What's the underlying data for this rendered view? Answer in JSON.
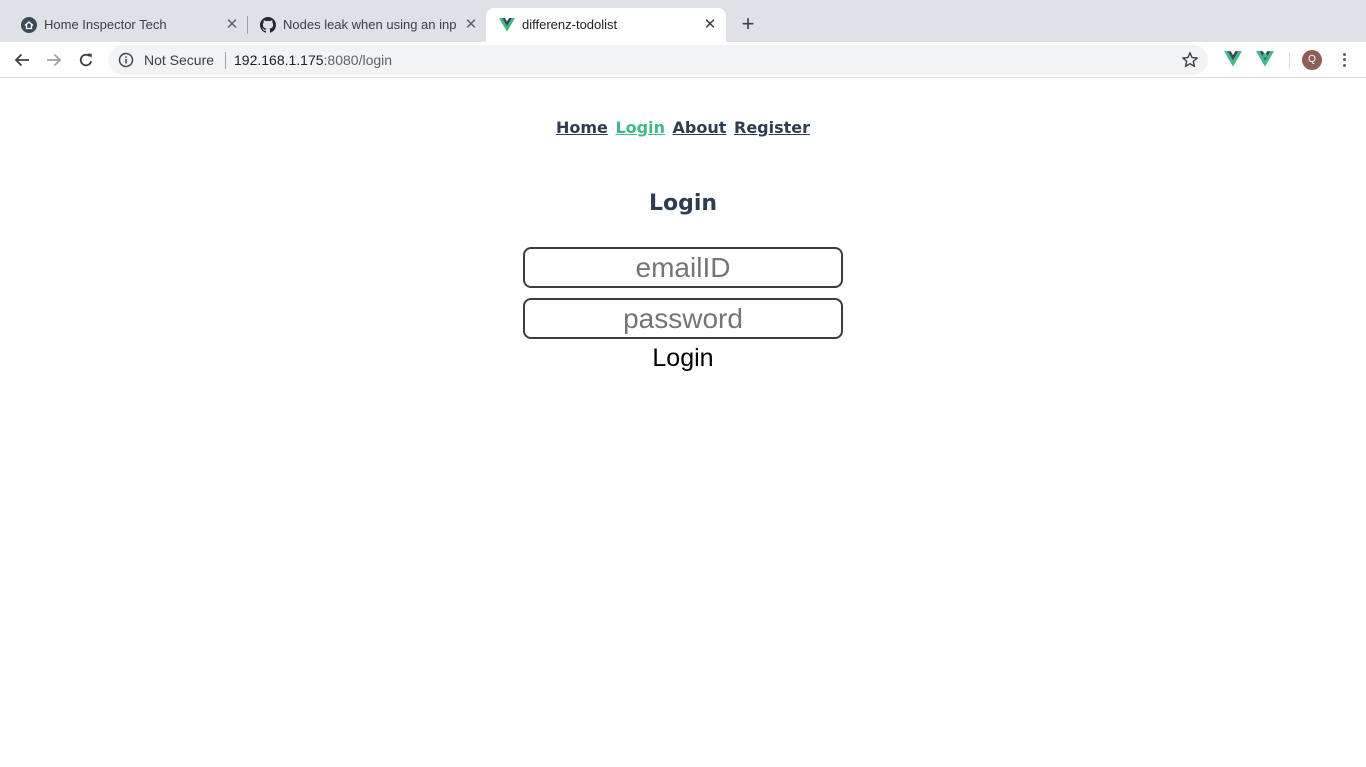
{
  "browser": {
    "tabs": [
      {
        "title": "Home Inspector Tech",
        "icon": "home-inspector-favicon"
      },
      {
        "title": "Nodes leak when using an input",
        "icon": "github-icon"
      },
      {
        "title": "differenz-todolist",
        "icon": "vue-icon"
      }
    ],
    "active_tab": 2,
    "security_label": "Not Secure",
    "url_host": "192.168.1.175",
    "url_rest": ":8080/login",
    "avatar_initial": "Q",
    "colors": {
      "tabstrip": "#dee1e6",
      "vue_green": "#42b883",
      "vue_dark": "#35495e"
    }
  },
  "nav": {
    "links": [
      "Home",
      "Login",
      "About",
      "Register"
    ],
    "active": "Login",
    "colors": {
      "text": "#2c3e50",
      "active": "#42b983"
    }
  },
  "login": {
    "heading": "Login",
    "email_placeholder": "emailID",
    "password_placeholder": "password",
    "button_label": "Login"
  }
}
